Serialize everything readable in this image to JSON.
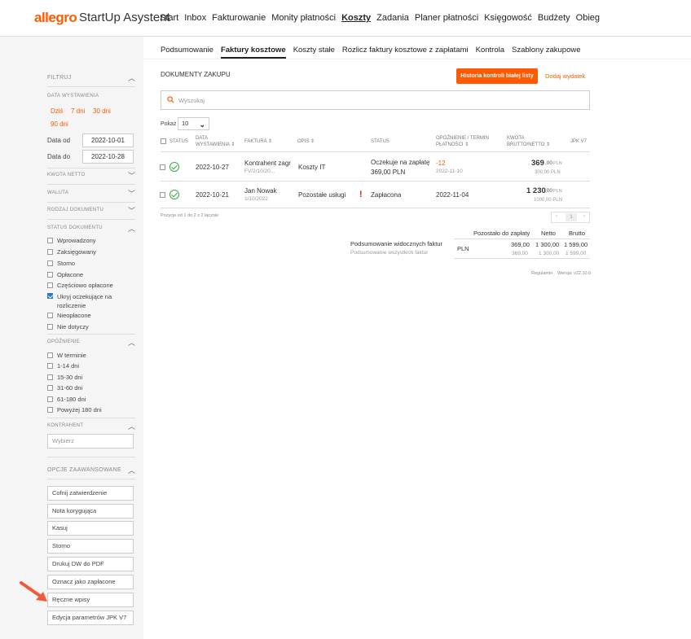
{
  "brand": {
    "logo": "allegro",
    "app": "StartUp Asystent"
  },
  "nav": {
    "items": [
      "Start",
      "Inbox",
      "Fakturowanie",
      "Monity płatności",
      "Koszty",
      "Zadania",
      "Planer płatności",
      "Księgowość",
      "Budżety",
      "Obieg"
    ],
    "active": "Koszty"
  },
  "subnav": {
    "items": [
      "Podsumowanie",
      "Faktury kosztowe",
      "Koszty stałe",
      "Rozlicz faktury kosztowe z zapłatami",
      "Kontrola",
      "Szablony zakupowe"
    ],
    "active": "Faktury kosztowe"
  },
  "sidebar": {
    "filter_title": "FILTRUJ",
    "date_section": "DATA WYSTAWIENIA",
    "quick": [
      "Dziś",
      "7 dni",
      "30 dni",
      "90 dni"
    ],
    "date_from_label": "Data od",
    "date_from": "2022-10-01",
    "date_to_label": "Data do",
    "date_to": "2022-10-28",
    "kwota_netto": "KWOTA NETTO",
    "waluta": "WALUTA",
    "rodzaj": "RODZAJ DOKUMENTU",
    "status_title": "STATUS DOKUMENTU",
    "status": [
      {
        "label": "Wprowadzony",
        "checked": false
      },
      {
        "label": "Zaksięgowany",
        "checked": false
      },
      {
        "label": "Storno",
        "checked": false
      },
      {
        "label": "Opłacone",
        "checked": false
      },
      {
        "label": "Częściowo opłacone",
        "checked": false
      },
      {
        "label": "Ukryj oczekujące na rozliczenie",
        "checked": true
      },
      {
        "label": "Nieopłacone",
        "checked": false
      },
      {
        "label": "Nie dotyczy",
        "checked": false
      }
    ],
    "opoznienie_title": "OPÓŹNIENIE",
    "opoznienie": [
      "W terminie",
      "1-14 dni",
      "15-30 dni",
      "31-60 dni",
      "61-180 dni",
      "Powyżej 180 dni"
    ],
    "kontrahent_title": "KONTRAHENT",
    "kontrahent_placeholder": "Wybierz",
    "advanced_title": "OPCJE ZAAWANSOWANE",
    "advanced": [
      "Cofnij zatwierdzenie",
      "Nota korygująca",
      "Kasuj",
      "Storno",
      "Drukuj DW do PDF",
      "Oznacz jako zapłacone",
      "Ręczne wpisy",
      "Edycja parametrów JPK V7"
    ]
  },
  "main": {
    "title": "DOKUMENTY ZAKUPU",
    "history_button": "Historia kontroli białej listy",
    "add_link": "Dodaj wydatek",
    "search_placeholder": "Wyszukaj",
    "pokaz_label": "Pokaż",
    "pokaz_value": "10",
    "columns": {
      "status": "STATUS",
      "date_l1": "DATA",
      "date_l2": "WYSTAWIENIA ⇕",
      "faktura": "FAKTURA ⇕",
      "opis": "OPIS ⇕",
      "status2": "STATUS",
      "delay_l1": "OPÓŹNIENIE / TERMIN",
      "delay_l2": "PŁATNOŚCI ⇕",
      "amount_l1": "KWOTA",
      "amount_l2": "BRUTTO/NETTO ⇕",
      "jpk": "JPK V7"
    },
    "rows": [
      {
        "date": "2022-10-27",
        "contractor": "Kontrahent zagr",
        "invoice_no": "FV/2/10/20...",
        "opis": "Koszty IT",
        "status_l1": "Oczekuje na zapłatę",
        "status_l2": "369,00 PLN",
        "delay": "-12",
        "due": "2022-11-10",
        "gross_int": "369",
        "gross_dec": ",00",
        "gross_cur": "PLN",
        "net": "300,00 PLN"
      },
      {
        "date": "2022-10-21",
        "contractor": "Jan Nowak",
        "invoice_no": "1/10/2022",
        "opis": "Pozostałe usługi",
        "status_l1": "Zapłacona",
        "due": "2022-11-04",
        "gross_int": "1 230",
        "gross_dec": ",00",
        "gross_cur": "PLN",
        "net": "1000,00 PLN"
      }
    ],
    "footnote": "Pozycje od 1 do 2 z 2 łącznie",
    "pager": {
      "prev": "‹",
      "page": "1",
      "next": "›"
    },
    "summary": {
      "h_remaining": "Pozostało do zapłaty",
      "h_net": "Netto",
      "h_gross": "Brutto",
      "label_visible": "Podsumowanie widocznych faktur",
      "label_all": "Podsumowanie wszystkich faktur",
      "currency": "PLN",
      "visible": [
        "369,00",
        "1 300,00",
        "1 599,00"
      ],
      "all": [
        "369,00",
        "1 300,00",
        "1 599,00"
      ]
    },
    "regulamin": "Regulamin",
    "version": "Wersja: v22.10.6"
  },
  "colors": {
    "accent": "#ff5a00",
    "ok": "#3aa843",
    "error": "#d62020"
  }
}
